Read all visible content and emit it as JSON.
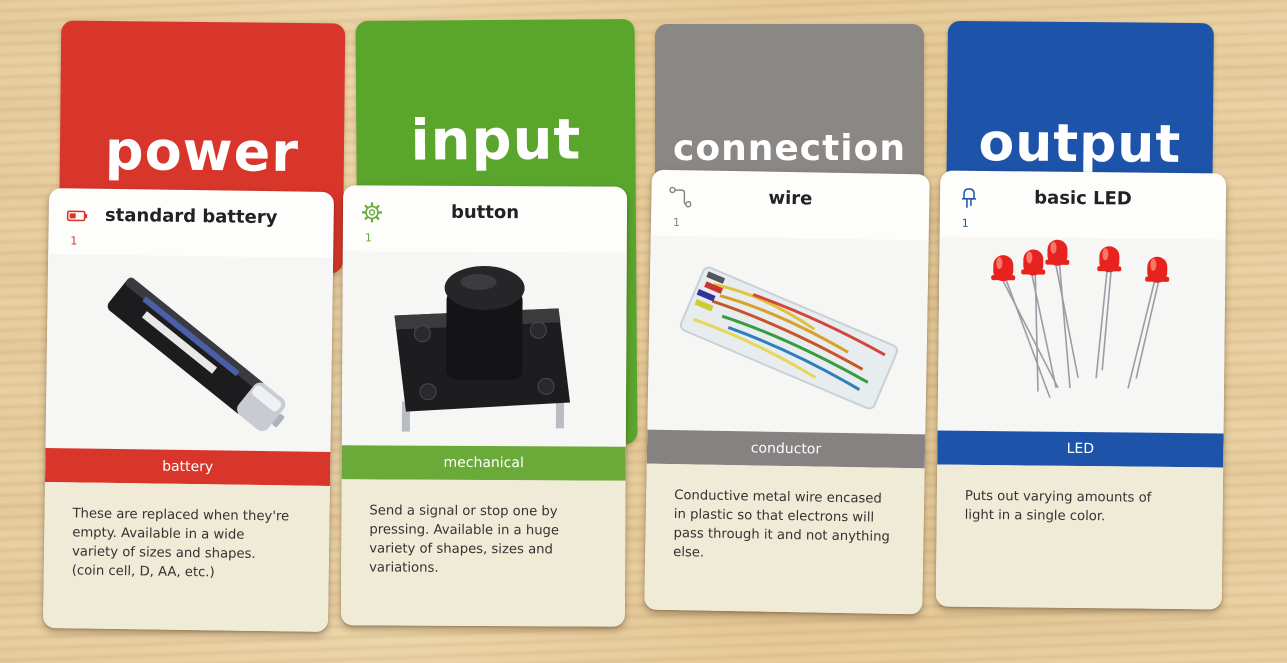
{
  "categories": [
    {
      "title": "power",
      "color": "#d9362b"
    },
    {
      "title": "input",
      "color": "#5aa62d"
    },
    {
      "title": "connection",
      "color": "#8b8784"
    },
    {
      "title": "output",
      "color": "#1d53a8"
    }
  ],
  "cards": [
    {
      "name": "standard battery",
      "count": "1",
      "icon": "battery-icon",
      "band_label": "battery",
      "band_color": "#d9362b",
      "description": "These are replaced when they're\nempty. Available in a wide\nvariety of sizes and shapes.\n(coin cell, D, AA, etc.)"
    },
    {
      "name": "button",
      "count": "1",
      "icon": "gear-icon",
      "band_label": "mechanical",
      "band_color": "#6aaa38",
      "description": "Send a signal or stop one by\npressing. Available in a huge\nvariety of shapes, sizes and\nvariations."
    },
    {
      "name": "wire",
      "count": "1",
      "icon": "wire-path-icon",
      "band_label": "conductor",
      "band_color": "#858281",
      "description": "Conductive metal wire encased\nin plastic so that electrons will\npass through it and not anything\nelse."
    },
    {
      "name": "basic LED",
      "count": "1",
      "icon": "led-icon",
      "band_label": "LED",
      "band_color": "#1d53a8",
      "description": "Puts out varying amounts of\nlight in a single color."
    }
  ]
}
